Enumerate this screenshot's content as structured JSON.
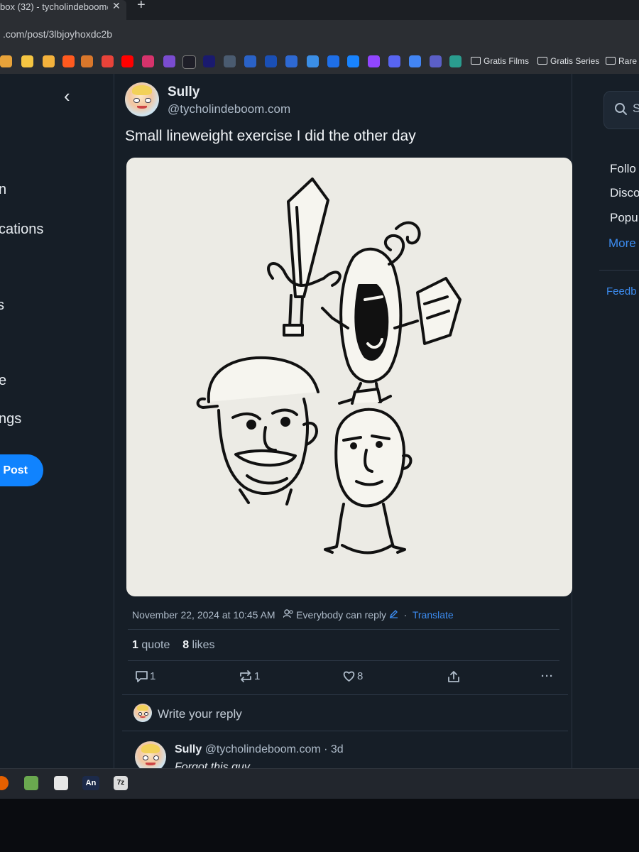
{
  "browser": {
    "tab_title": "box (32) - tycholindeboom@",
    "tab_close": "✕",
    "new_tab": "+",
    "url": ".com/post/3lbjoyhoxdc2b",
    "bookmark_folders": [
      "Gratis Films",
      "Gratis Series",
      "Rare"
    ]
  },
  "nav": {
    "back_glyph": "‹",
    "items": [
      "n",
      "cations",
      "s",
      "e",
      "ngs"
    ],
    "post_button": "Post"
  },
  "post": {
    "author_name": "Sully",
    "author_handle": "@tycholindeboom.com",
    "text": "Small lineweight exercise I did the other day",
    "timestamp": "November 22, 2024 at 10:45 AM",
    "reply_setting": "Everybody can reply",
    "separator": "·",
    "translate": "Translate",
    "quote_count": "1",
    "quote_label": "quote",
    "like_count": "8",
    "like_label": "likes",
    "actions": {
      "reply_count": "1",
      "repost_count": "1",
      "like_count": "8",
      "more_glyph": "···"
    }
  },
  "reply_box": {
    "placeholder": "Write your reply"
  },
  "reply": {
    "author_name": "Sully",
    "author_handle": "@tycholindeboom.com · 3d",
    "text": "Forgot this guy"
  },
  "right_sidebar": {
    "search_placeholder": "S",
    "links": [
      "Follo",
      "Disco",
      "Popu",
      "More"
    ],
    "feedback": "Feedb"
  },
  "taskbar": {
    "apps": [
      "An",
      "7z"
    ]
  },
  "colors": {
    "accent": "#1083fe",
    "link": "#3c8cf0",
    "page_bg": "#161e27",
    "image_bg": "#ecebe5"
  }
}
